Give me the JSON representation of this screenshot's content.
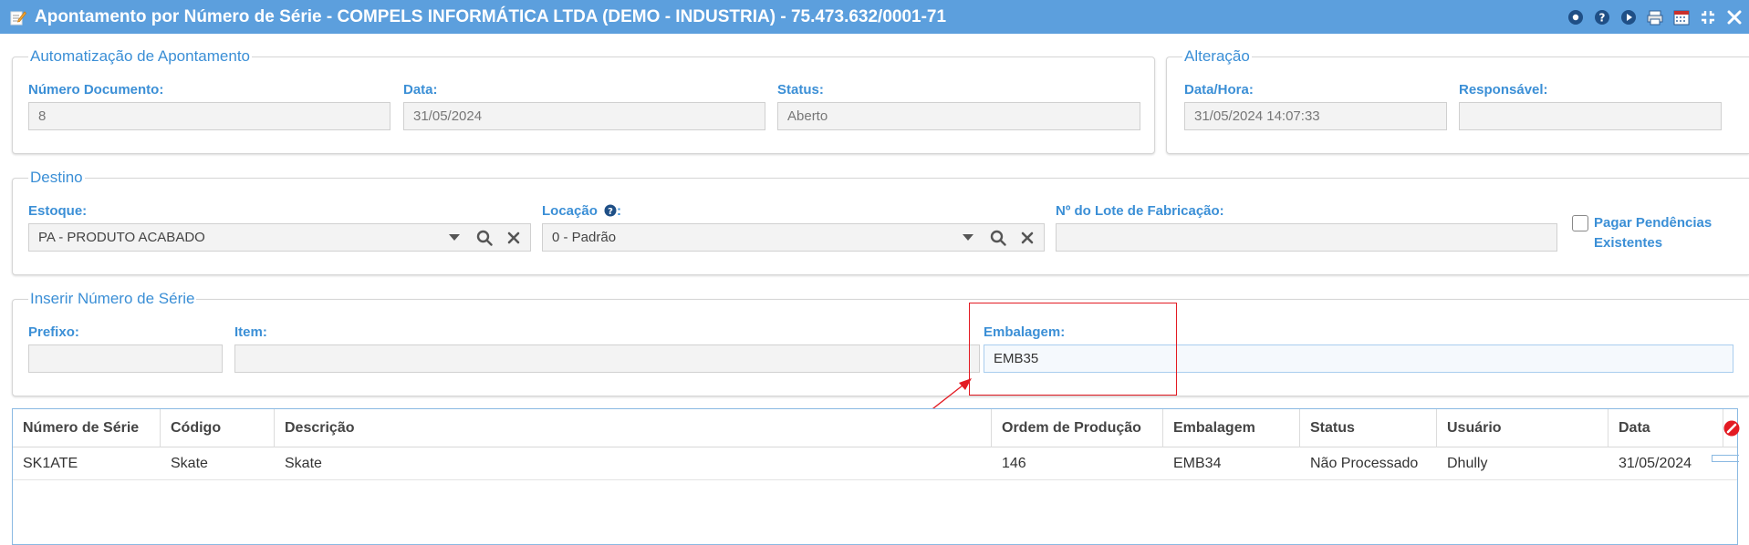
{
  "window": {
    "title": "Apontamento por Número de Série - COMPELS INFORMÁTICA LTDA (DEMO - INDUSTRIA) - 75.473.632/0001-71"
  },
  "automatizacao": {
    "legend": "Automatização de Apontamento",
    "numero_label": "Número Documento:",
    "numero_value": "8",
    "data_label": "Data:",
    "data_value": "31/05/2024",
    "status_label": "Status:",
    "status_value": "Aberto"
  },
  "alteracao": {
    "legend": "Alteração",
    "datahora_label": "Data/Hora:",
    "datahora_value": "31/05/2024 14:07:33",
    "responsavel_label": "Responsável:",
    "responsavel_value": ""
  },
  "destino": {
    "legend": "Destino",
    "estoque_label": "Estoque:",
    "estoque_value": "PA - PRODUTO ACABADO",
    "locacao_label": "Locação",
    "locacao_suffix": ":",
    "locacao_value": "0 - Padrão",
    "lote_label": "Nº do Lote de Fabricação:",
    "lote_value": "",
    "pagar_label": "Pagar Pendências Existentes"
  },
  "inserir": {
    "legend": "Inserir Número de Série",
    "prefixo_label": "Prefixo:",
    "prefixo_value": "",
    "item_label": "Item:",
    "item_value": "",
    "embalagem_label": "Embalagem:",
    "embalagem_value": "EMB35"
  },
  "table": {
    "columns": [
      "Número de Série",
      "Código",
      "Descrição",
      "Ordem de Produção",
      "Embalagem",
      "Status",
      "Usuário",
      "Data"
    ],
    "rows": [
      [
        "SK1ATE",
        "Skate",
        "Skate",
        "146",
        "EMB34",
        "Não Processado",
        "Dhully",
        "31/05/2024"
      ]
    ]
  },
  "icons": {
    "title_icon": "edit-document-icon",
    "toolbar": [
      "record-icon",
      "help-icon",
      "play-icon",
      "print-icon",
      "calendar-icon",
      "compress-icon",
      "close-icon"
    ]
  },
  "colors": {
    "titlebar": "#5c9fdd",
    "accent": "#3b8fd6",
    "annotation": "#e31b23"
  }
}
